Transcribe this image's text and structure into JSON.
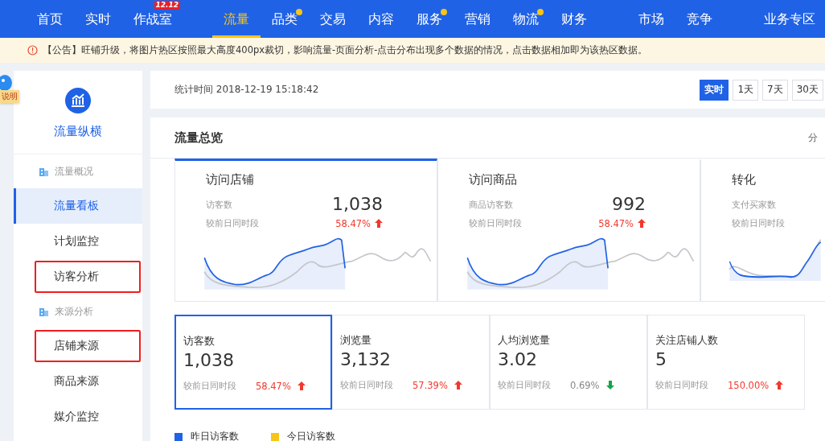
{
  "nav": {
    "items": [
      {
        "label": "首页",
        "selected": false,
        "dot": false
      },
      {
        "label": "实时",
        "selected": false,
        "dot": false
      },
      {
        "label": "作战室",
        "selected": false,
        "dot": false,
        "badge": "12.12"
      },
      {
        "kind": "divider"
      },
      {
        "label": "流量",
        "selected": true,
        "dot": false
      },
      {
        "label": "品类",
        "selected": false,
        "dot": true
      },
      {
        "label": "交易",
        "selected": false,
        "dot": false
      },
      {
        "label": "内容",
        "selected": false,
        "dot": false
      },
      {
        "label": "服务",
        "selected": false,
        "dot": true
      },
      {
        "label": "营销",
        "selected": false,
        "dot": false
      },
      {
        "label": "物流",
        "selected": false,
        "dot": true
      },
      {
        "label": "财务",
        "selected": false,
        "dot": false
      },
      {
        "kind": "divider"
      },
      {
        "label": "市场",
        "selected": false,
        "dot": false
      },
      {
        "label": "竞争",
        "selected": false,
        "dot": false
      },
      {
        "kind": "divider"
      },
      {
        "label": "业务专区",
        "selected": false,
        "dot": false
      }
    ]
  },
  "notice": {
    "text": "【公告】旺铺升级，将图片热区按照最大高度400px裁切，影响流量-页面分析-点击分布出现多个数据的情况，点击数据相加即为该热区数据。"
  },
  "help_tag": {
    "label": "说明"
  },
  "sidebar": {
    "title": "流量纵横",
    "items": [
      {
        "kind": "section",
        "label": "流量概况"
      },
      {
        "kind": "link",
        "label": "流量看板",
        "selected": true,
        "highlighted": false
      },
      {
        "kind": "link",
        "label": "计划监控",
        "selected": false,
        "highlighted": false
      },
      {
        "kind": "link",
        "label": "访客分析",
        "selected": false,
        "highlighted": true
      },
      {
        "kind": "section",
        "label": "来源分析"
      },
      {
        "kind": "link",
        "label": "店铺来源",
        "selected": false,
        "highlighted": true
      },
      {
        "kind": "link",
        "label": "商品来源",
        "selected": false,
        "highlighted": false
      },
      {
        "kind": "link",
        "label": "媒介监控",
        "selected": false,
        "highlighted": false
      }
    ]
  },
  "stats_bar": {
    "time": "统计时间 2018-12-19 15:18:42",
    "ranges": [
      {
        "label": "实时",
        "selected": true
      },
      {
        "label": "1天",
        "selected": false
      },
      {
        "label": "7天",
        "selected": false
      },
      {
        "label": "30天",
        "selected": false
      }
    ]
  },
  "overview": {
    "title": "流量总览",
    "right_link": "分",
    "tiles": [
      {
        "title": "访问店铺",
        "metric": "访客数",
        "value": "1,038",
        "compare": "较前日同时段",
        "change": "58.47%",
        "rising": true,
        "selected": true
      },
      {
        "title": "访问商品",
        "metric": "商品访客数",
        "value": "992",
        "compare": "较前日同时段",
        "change": "58.47%",
        "rising": true,
        "selected": false
      },
      {
        "title": "转化",
        "metric": "支付买家数",
        "compare": "较前日同时段",
        "selected": false
      }
    ],
    "metrics": [
      {
        "label": "访客数",
        "value": "1,038",
        "compare": "较前日同时段",
        "change": "58.47%",
        "rising": true,
        "selected": true
      },
      {
        "label": "浏览量",
        "value": "3,132",
        "compare": "较前日同时段",
        "change": "57.39%",
        "rising": true,
        "selected": false
      },
      {
        "label": "人均浏览量",
        "value": "3.02",
        "compare": "较前日同时段",
        "change": "0.69%",
        "rising": false,
        "selected": false
      },
      {
        "label": "关注店铺人数",
        "value": "5",
        "compare": "较前日同时段",
        "change": "150.00%",
        "rising": true,
        "selected": false
      }
    ],
    "legend": [
      {
        "label": "昨日访客数",
        "color": "#2062e6"
      },
      {
        "label": "今日访客数",
        "color": "#f5c518"
      }
    ]
  }
}
